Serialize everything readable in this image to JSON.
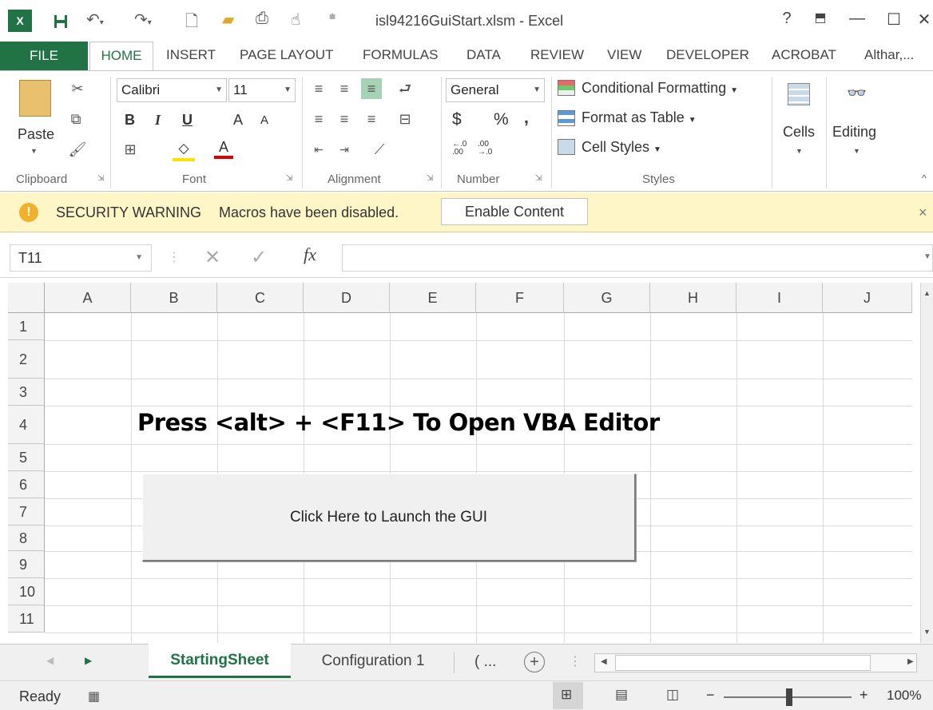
{
  "window": {
    "title": "isl94216GuiStart.xlsm - Excel",
    "help": "?",
    "restore_icon": "ribbon-display-icon",
    "minimize": "—",
    "maximize": "☐",
    "close": "✕"
  },
  "tabs": [
    "FILE",
    "HOME",
    "INSERT",
    "PAGE LAYOUT",
    "FORMULAS",
    "DATA",
    "REVIEW",
    "VIEW",
    "DEVELOPER",
    "ACROBAT"
  ],
  "account": "Althar,...",
  "ribbon": {
    "clipboard": {
      "paste": "Paste",
      "label": "Clipboard"
    },
    "font": {
      "name": "Calibri",
      "size": "11",
      "label": "Font",
      "bold": "B",
      "italic": "I",
      "underline": "U",
      "grow": "A",
      "shrink": "A",
      "font_color": "A"
    },
    "alignment": {
      "label": "Alignment"
    },
    "number": {
      "format": "General",
      "currency": "$",
      "percent": "%",
      "comma": ",",
      "label": "Number",
      "inc_dec": "←.0\n.00",
      "dec_dec": ".00\n→.0"
    },
    "styles": {
      "conditional": "Conditional Formatting",
      "table": "Format as Table",
      "cell_styles": "Cell Styles",
      "label": "Styles"
    },
    "cells": {
      "label": "Cells"
    },
    "editing": {
      "label": "Editing"
    }
  },
  "security": {
    "title": "SECURITY WARNING",
    "message": "Macros have been disabled.",
    "button": "Enable Content"
  },
  "formula_bar": {
    "name_box": "T11",
    "fx": "fx",
    "value": ""
  },
  "grid": {
    "columns": [
      "A",
      "B",
      "C",
      "D",
      "E",
      "F",
      "G",
      "H",
      "I",
      "J"
    ],
    "rows": [
      "1",
      "2",
      "3",
      "4",
      "5",
      "6",
      "7",
      "8",
      "9",
      "10",
      "11"
    ],
    "headline": "Press <alt> + <F11>  To Open VBA Editor",
    "button_label": "Click Here to Launch the GUI"
  },
  "sheets": {
    "active": "StartingSheet",
    "other": "Configuration 1",
    "more": "( ..."
  },
  "status": {
    "ready": "Ready",
    "zoom": "100%"
  }
}
